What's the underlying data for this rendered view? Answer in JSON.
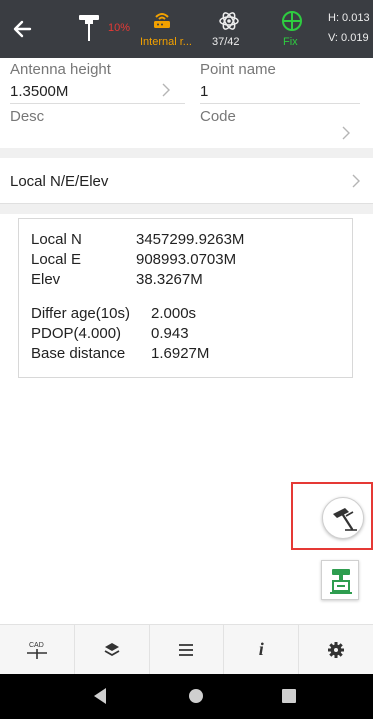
{
  "status": {
    "battery": "10%",
    "network": "Internal r...",
    "satellites": "37/42",
    "fix": "Fix",
    "h_acc": "H: 0.013",
    "v_acc": "V: 0.019"
  },
  "form": {
    "antenna_height_label": "Antenna height",
    "antenna_height_value": "1.3500M",
    "point_name_label": "Point name",
    "point_name_value": "1",
    "desc_label": "Desc",
    "code_label": "Code"
  },
  "coord_selector": {
    "label": "Local N/E/Elev"
  },
  "readout": {
    "rows": [
      {
        "key": "Local N",
        "value": "3457299.9263M"
      },
      {
        "key": "Local E",
        "value": "908993.0703M"
      },
      {
        "key": "Elev",
        "value": "38.3267M"
      },
      {
        "key": "Differ age(10s)",
        "value": "2.000s"
      },
      {
        "key": "PDOP(4.000)",
        "value": "0.943"
      },
      {
        "key": "Base distance",
        "value": "1.6927M"
      }
    ]
  },
  "toolbar": {
    "cad_label": "CAD",
    "info_label": "i"
  },
  "icons": {
    "back": "arrow-left-icon",
    "gnss": "gnss-receiver-icon",
    "network": "network-modem-icon",
    "satellite": "satellite-icon",
    "fix": "crosshair-icon",
    "pole": "survey-pole-icon",
    "survey": "station-survey-icon",
    "layers": "layers-icon",
    "menu": "menu-icon",
    "settings": "gear-icon"
  },
  "colors": {
    "topbar": "#3a3d42",
    "battery": "#e53935",
    "network": "#f2a100",
    "fix": "#2ecc40",
    "accent_green": "#2e9d4f",
    "highlight": "#e53935"
  }
}
